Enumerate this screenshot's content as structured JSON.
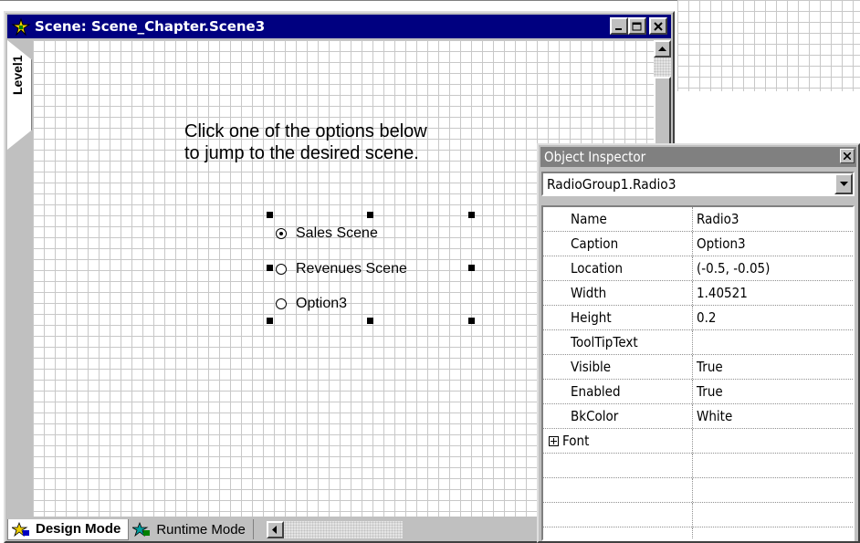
{
  "scene_window": {
    "title": "Scene: Scene_Chapter.Scene3",
    "side_tab_label": "Level1",
    "instructions": [
      "Click one of the options below",
      "to jump to the desired scene."
    ],
    "radio_options": [
      {
        "label": "Sales Scene",
        "checked": true
      },
      {
        "label": "Revenues Scene",
        "checked": false
      },
      {
        "label": "Option3",
        "checked": false
      }
    ],
    "modes": [
      {
        "label": "Design Mode",
        "active": true,
        "icon": "design-mode-icon"
      },
      {
        "label": "Runtime Mode",
        "active": false,
        "icon": "runtime-mode-icon"
      }
    ]
  },
  "inspector": {
    "title": "Object Inspector",
    "selected_object": "RadioGroup1.Radio3",
    "properties": [
      {
        "name": "Name",
        "value": "Radio3"
      },
      {
        "name": "Caption",
        "value": "Option3"
      },
      {
        "name": "Location",
        "value": "(-0.5, -0.05)"
      },
      {
        "name": "Width",
        "value": "1.40521"
      },
      {
        "name": "Height",
        "value": "0.2"
      },
      {
        "name": "ToolTipText",
        "value": ""
      },
      {
        "name": "Visible",
        "value": "True"
      },
      {
        "name": "Enabled",
        "value": "True"
      },
      {
        "name": "BkColor",
        "value": "White"
      }
    ],
    "font_property": "Font"
  },
  "colors": {
    "title_bar_active": "#000080",
    "title_bar_inactive": "#808080",
    "window_face": "#c0c0c0"
  }
}
